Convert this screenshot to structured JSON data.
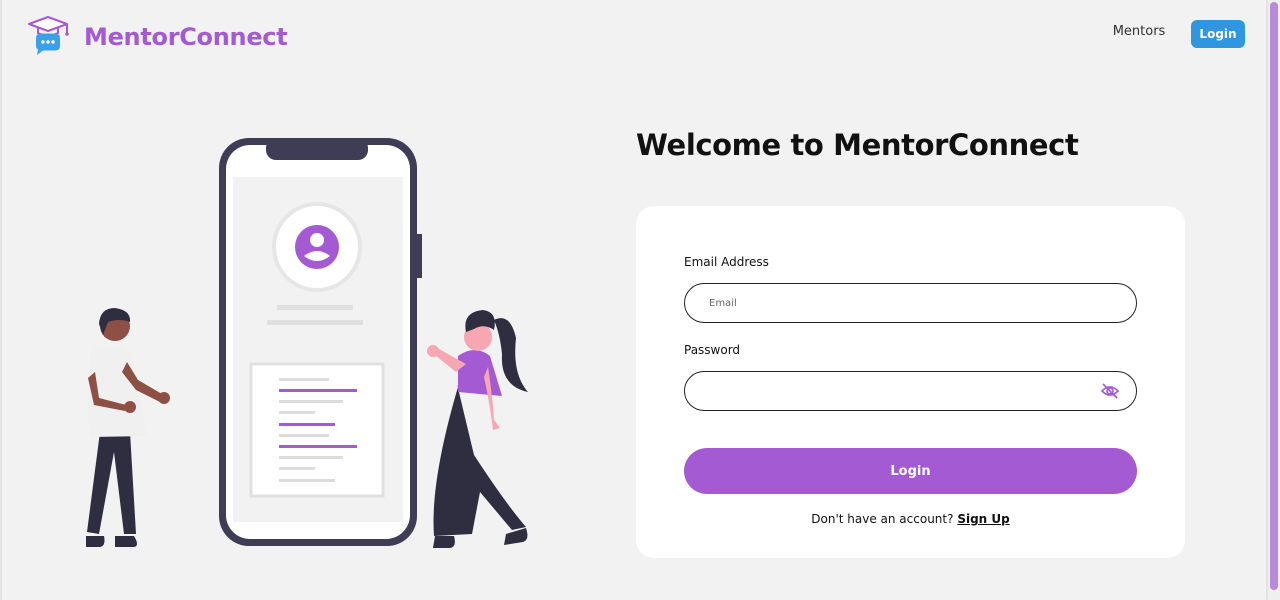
{
  "brand": {
    "name": "MentorConnect",
    "color": "#a35ad2",
    "logo_icon": "graduation-cap-chat-bubble-icon"
  },
  "nav": {
    "mentors_label": "Mentors",
    "login_label": "Login",
    "login_color": "#2f96e0"
  },
  "hero": {
    "title": "Welcome to MentorConnect",
    "illustration": "two-people-with-phone-profile-illustration"
  },
  "form": {
    "email": {
      "label": "Email Address",
      "placeholder": "Email",
      "value": ""
    },
    "password": {
      "label": "Password",
      "value": "",
      "toggle_icon": "eye-slash-icon"
    },
    "submit_label": "Login",
    "submit_color": "#a35ad2",
    "signup_prompt": "Don't have an account?",
    "signup_link": "Sign Up"
  }
}
